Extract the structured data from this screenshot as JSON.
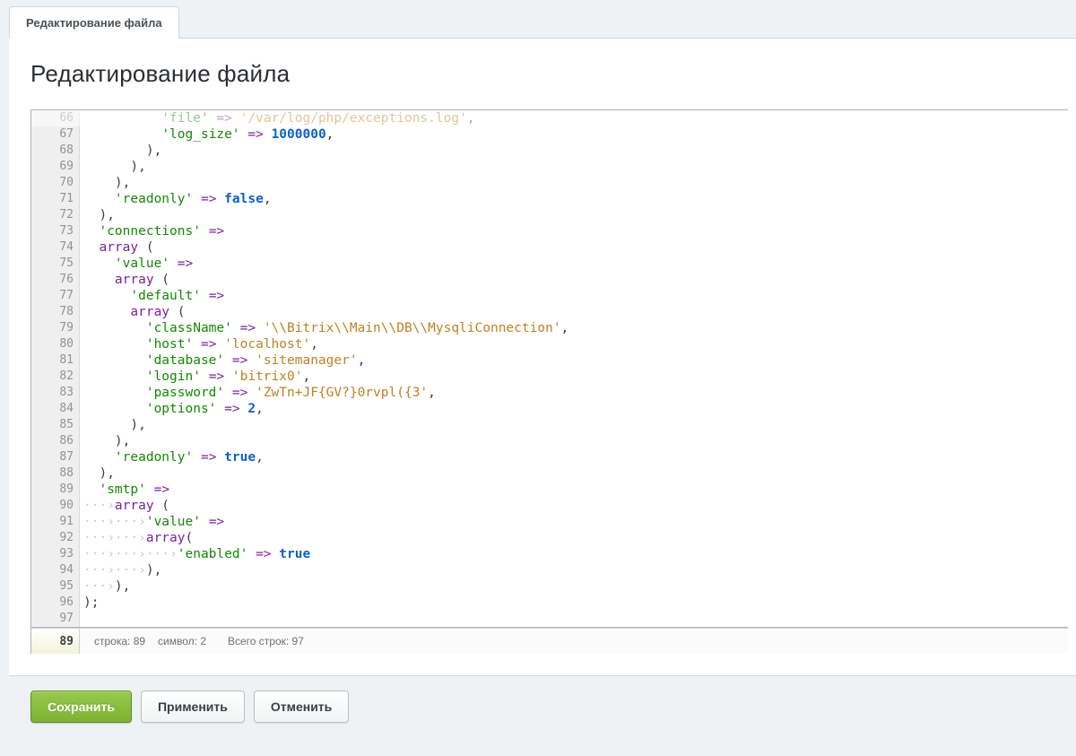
{
  "tabs": [
    {
      "label": "Редактирование файла",
      "active": true
    }
  ],
  "page_title": "Редактирование файла",
  "editor": {
    "goto_line": "89",
    "status": {
      "row_label": "строка: 89",
      "col_label": "символ: 2",
      "total_label": "Всего строк: 97"
    },
    "lines": [
      {
        "n": 66,
        "tokens": [
          [
            "p",
            "          "
          ],
          [
            "sKey",
            "'file'"
          ],
          [
            "p",
            " "
          ],
          [
            "arrow",
            "=>"
          ],
          [
            "p",
            " "
          ],
          [
            "sVal",
            "'/var/log/php/exceptions.log'"
          ],
          [
            "p",
            ","
          ]
        ],
        "faded": true
      },
      {
        "n": 67,
        "tokens": [
          [
            "p",
            "          "
          ],
          [
            "sKey",
            "'log_size'"
          ],
          [
            "p",
            " "
          ],
          [
            "arrow",
            "=>"
          ],
          [
            "p",
            " "
          ],
          [
            "num",
            "1000000"
          ],
          [
            "p",
            ","
          ]
        ]
      },
      {
        "n": 68,
        "tokens": [
          [
            "p",
            "        "
          ],
          [
            "p",
            ")"
          ],
          [
            "p",
            ","
          ]
        ]
      },
      {
        "n": 69,
        "tokens": [
          [
            "p",
            "      "
          ],
          [
            "p",
            ")"
          ],
          [
            "p",
            ","
          ]
        ]
      },
      {
        "n": 70,
        "tokens": [
          [
            "p",
            "    "
          ],
          [
            "p",
            ")"
          ],
          [
            "p",
            ","
          ]
        ]
      },
      {
        "n": 71,
        "tokens": [
          [
            "p",
            "    "
          ],
          [
            "sKey",
            "'readonly'"
          ],
          [
            "p",
            " "
          ],
          [
            "arrow",
            "=>"
          ],
          [
            "p",
            " "
          ],
          [
            "bool",
            "false"
          ],
          [
            "p",
            ","
          ]
        ]
      },
      {
        "n": 72,
        "tokens": [
          [
            "p",
            "  "
          ],
          [
            "p",
            ")"
          ],
          [
            "p",
            ","
          ]
        ]
      },
      {
        "n": 73,
        "tokens": [
          [
            "p",
            "  "
          ],
          [
            "sKey",
            "'connections'"
          ],
          [
            "p",
            " "
          ],
          [
            "arrow",
            "=>"
          ]
        ]
      },
      {
        "n": 74,
        "tokens": [
          [
            "p",
            "  "
          ],
          [
            "kw",
            "array"
          ],
          [
            "p",
            " ("
          ]
        ]
      },
      {
        "n": 75,
        "tokens": [
          [
            "p",
            "    "
          ],
          [
            "sKey",
            "'value'"
          ],
          [
            "p",
            " "
          ],
          [
            "arrow",
            "=>"
          ]
        ]
      },
      {
        "n": 76,
        "tokens": [
          [
            "p",
            "    "
          ],
          [
            "kw",
            "array"
          ],
          [
            "p",
            " ("
          ]
        ]
      },
      {
        "n": 77,
        "tokens": [
          [
            "p",
            "      "
          ],
          [
            "sKey",
            "'default'"
          ],
          [
            "p",
            " "
          ],
          [
            "arrow",
            "=>"
          ]
        ]
      },
      {
        "n": 78,
        "tokens": [
          [
            "p",
            "      "
          ],
          [
            "kw",
            "array"
          ],
          [
            "p",
            " ("
          ]
        ]
      },
      {
        "n": 79,
        "tokens": [
          [
            "p",
            "        "
          ],
          [
            "sKey",
            "'className'"
          ],
          [
            "p",
            " "
          ],
          [
            "arrow",
            "=>"
          ],
          [
            "p",
            " "
          ],
          [
            "sVal",
            "'\\\\Bitrix\\\\Main\\\\DB\\\\MysqliConnection'"
          ],
          [
            "p",
            ","
          ]
        ]
      },
      {
        "n": 80,
        "tokens": [
          [
            "p",
            "        "
          ],
          [
            "sKey",
            "'host'"
          ],
          [
            "p",
            " "
          ],
          [
            "arrow",
            "=>"
          ],
          [
            "p",
            " "
          ],
          [
            "sVal",
            "'localhost'"
          ],
          [
            "p",
            ","
          ]
        ]
      },
      {
        "n": 81,
        "tokens": [
          [
            "p",
            "        "
          ],
          [
            "sKey",
            "'database'"
          ],
          [
            "p",
            " "
          ],
          [
            "arrow",
            "=>"
          ],
          [
            "p",
            " "
          ],
          [
            "sVal",
            "'sitemanager'"
          ],
          [
            "p",
            ","
          ]
        ]
      },
      {
        "n": 82,
        "tokens": [
          [
            "p",
            "        "
          ],
          [
            "sKey",
            "'login'"
          ],
          [
            "p",
            " "
          ],
          [
            "arrow",
            "=>"
          ],
          [
            "p",
            " "
          ],
          [
            "sVal",
            "'bitrix0'"
          ],
          [
            "p",
            ","
          ]
        ]
      },
      {
        "n": 83,
        "tokens": [
          [
            "p",
            "        "
          ],
          [
            "sKey",
            "'password'"
          ],
          [
            "p",
            " "
          ],
          [
            "arrow",
            "=>"
          ],
          [
            "p",
            " "
          ],
          [
            "sVal",
            "'ZwTn+JF{GV?}0rvpl({3'"
          ],
          [
            "p",
            ","
          ]
        ]
      },
      {
        "n": 84,
        "tokens": [
          [
            "p",
            "        "
          ],
          [
            "sKey",
            "'options'"
          ],
          [
            "p",
            " "
          ],
          [
            "arrow",
            "=>"
          ],
          [
            "p",
            " "
          ],
          [
            "num",
            "2"
          ],
          [
            "p",
            ","
          ]
        ]
      },
      {
        "n": 85,
        "tokens": [
          [
            "p",
            "      "
          ],
          [
            "p",
            ")"
          ],
          [
            "p",
            ","
          ]
        ]
      },
      {
        "n": 86,
        "tokens": [
          [
            "p",
            "    "
          ],
          [
            "p",
            ")"
          ],
          [
            "p",
            ","
          ]
        ]
      },
      {
        "n": 87,
        "tokens": [
          [
            "p",
            "    "
          ],
          [
            "sKey",
            "'readonly'"
          ],
          [
            "p",
            " "
          ],
          [
            "arrow",
            "=>"
          ],
          [
            "p",
            " "
          ],
          [
            "bool",
            "true"
          ],
          [
            "p",
            ","
          ]
        ]
      },
      {
        "n": 88,
        "tokens": [
          [
            "p",
            "  "
          ],
          [
            "p",
            ")"
          ],
          [
            "p",
            ","
          ]
        ]
      },
      {
        "n": 89,
        "tokens": [
          [
            "p",
            "  "
          ],
          [
            "sKey",
            "'smtp'"
          ],
          [
            "p",
            " "
          ],
          [
            "arrow",
            "=>"
          ]
        ]
      },
      {
        "n": 90,
        "tokens": [
          [
            "invis",
            "···›"
          ],
          [
            "kw",
            "array"
          ],
          [
            "p",
            " ("
          ]
        ]
      },
      {
        "n": 91,
        "tokens": [
          [
            "invis",
            "···›···›"
          ],
          [
            "sKey",
            "'value'"
          ],
          [
            "p",
            " "
          ],
          [
            "arrow",
            "=>"
          ]
        ]
      },
      {
        "n": 92,
        "tokens": [
          [
            "invis",
            "···›···›"
          ],
          [
            "kw",
            "array"
          ],
          [
            "p",
            "("
          ]
        ]
      },
      {
        "n": 93,
        "tokens": [
          [
            "invis",
            "···›···›···›"
          ],
          [
            "sKey",
            "'enabled'"
          ],
          [
            "p",
            " "
          ],
          [
            "arrow",
            "=>"
          ],
          [
            "p",
            " "
          ],
          [
            "bool",
            "true"
          ]
        ]
      },
      {
        "n": 94,
        "tokens": [
          [
            "invis",
            "···›···›"
          ],
          [
            "p",
            ")"
          ],
          [
            "p",
            ","
          ]
        ]
      },
      {
        "n": 95,
        "tokens": [
          [
            "invis",
            "···›"
          ],
          [
            "p",
            ")"
          ],
          [
            "p",
            ","
          ]
        ]
      },
      {
        "n": 96,
        "tokens": [
          [
            "p",
            ")"
          ],
          [
            "p",
            ";"
          ]
        ]
      },
      {
        "n": 97,
        "tokens": []
      }
    ]
  },
  "buttons": {
    "save": "Сохранить",
    "apply": "Применить",
    "cancel": "Отменить"
  }
}
